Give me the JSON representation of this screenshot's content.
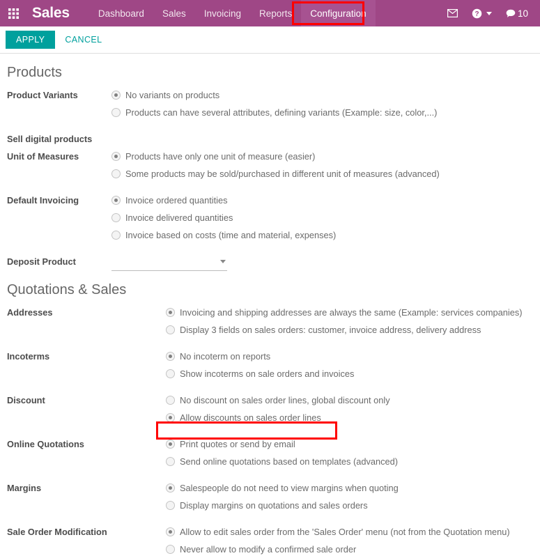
{
  "navbar": {
    "apps_icon": "apps-grid-icon",
    "brand": "Sales",
    "menu": [
      {
        "label": "Dashboard",
        "active": false
      },
      {
        "label": "Sales",
        "active": false
      },
      {
        "label": "Invoicing",
        "active": false
      },
      {
        "label": "Reports",
        "active": false
      },
      {
        "label": "Configuration",
        "active": true
      }
    ],
    "right": {
      "mail_icon": "envelope-icon",
      "help_icon": "question-circle-icon",
      "messages_icon": "speech-bubble-icon",
      "messages_count": "10"
    },
    "background_color": "#9F4786",
    "active_item_color": "#A75291"
  },
  "annotations": {
    "highlight_color": "#ff0000",
    "boxes": [
      "configuration-menu-item",
      "allow-discounts-option"
    ]
  },
  "control_panel": {
    "apply_label": "APPLY",
    "cancel_label": "CANCEL",
    "apply_color": "#00A09D"
  },
  "sections": [
    {
      "title": "Products",
      "rows": [
        {
          "label": "Product Variants",
          "options": [
            {
              "label": "No variants on products",
              "checked": true
            },
            {
              "label": "Products can have several attributes, defining variants (Example: size, color,...)",
              "checked": false
            }
          ]
        },
        {
          "label": "Sell digital products",
          "options": []
        },
        {
          "label": "Unit of Measures",
          "options": [
            {
              "label": "Products have only one unit of measure (easier)",
              "checked": true
            },
            {
              "label": "Some products may be sold/purchased in different unit of measures (advanced)",
              "checked": false
            }
          ]
        },
        {
          "label": "Default Invoicing",
          "options": [
            {
              "label": "Invoice ordered quantities",
              "checked": true
            },
            {
              "label": "Invoice delivered quantities",
              "checked": false
            },
            {
              "label": "Invoice based on costs (time and material, expenses)",
              "checked": false
            }
          ]
        },
        {
          "label": "Deposit Product",
          "field": {
            "type": "dropdown",
            "value": "",
            "placeholder": ""
          }
        }
      ]
    },
    {
      "title": "Quotations & Sales",
      "rows": [
        {
          "label": "Addresses",
          "options": [
            {
              "label": "Invoicing and shipping addresses are always the same (Example: services companies)",
              "checked": true
            },
            {
              "label": "Display 3 fields on sales orders: customer, invoice address, delivery address",
              "checked": false
            }
          ]
        },
        {
          "label": "Incoterms",
          "options": [
            {
              "label": "No incoterm on reports",
              "checked": true
            },
            {
              "label": "Show incoterms on sale orders and invoices",
              "checked": false
            }
          ]
        },
        {
          "label": "Discount",
          "options": [
            {
              "label": "No discount on sales order lines, global discount only",
              "checked": false
            },
            {
              "label": "Allow discounts on sales order lines",
              "checked": true
            }
          ]
        },
        {
          "label": "Online Quotations",
          "options": [
            {
              "label": "Print quotes or send by email",
              "checked": true
            },
            {
              "label": "Send online quotations based on templates (advanced)",
              "checked": false
            }
          ]
        },
        {
          "label": "Margins",
          "options": [
            {
              "label": "Salespeople do not need to view margins when quoting",
              "checked": true
            },
            {
              "label": "Display margins on quotations and sales orders",
              "checked": false
            }
          ]
        },
        {
          "label": "Sale Order Modification",
          "options": [
            {
              "label": "Allow to edit sales order from the 'Sales Order' menu (not from the Quotation menu)",
              "checked": true
            },
            {
              "label": "Never allow to modify a confirmed sale order",
              "checked": false
            }
          ]
        }
      ]
    }
  ]
}
